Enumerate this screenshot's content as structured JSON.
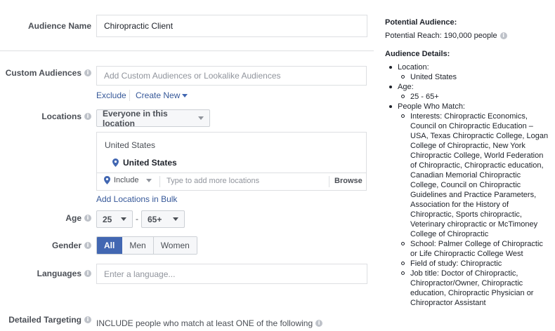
{
  "audience_name": {
    "label": "Audience Name",
    "value": "Chiropractic Client"
  },
  "custom_audiences": {
    "label": "Custom Audiences",
    "placeholder": "Add Custom Audiences or Lookalike Audiences",
    "exclude_link": "Exclude",
    "create_new_link": "Create New"
  },
  "locations": {
    "label": "Locations",
    "scope_select": "Everyone in this location",
    "group_label": "United States",
    "selected": "United States",
    "include_select": "Include",
    "search_placeholder": "Type to add more locations",
    "browse_button": "Browse",
    "bulk_link": "Add Locations in Bulk"
  },
  "age": {
    "label": "Age",
    "min": "25",
    "separator": "-",
    "max": "65+"
  },
  "gender": {
    "label": "Gender",
    "options": [
      "All",
      "Men",
      "Women"
    ],
    "selected": "All"
  },
  "languages": {
    "label": "Languages",
    "placeholder": "Enter a language..."
  },
  "detailed_targeting": {
    "label": "Detailed Targeting",
    "include_text": "INCLUDE people who match at least ONE of the following"
  },
  "sidebar": {
    "potential_audience_heading": "Potential Audience:",
    "potential_reach": "Potential Reach: 190,000 people",
    "audience_details_heading": "Audience Details:",
    "details": [
      {
        "label": "Location:",
        "sub": [
          "United States"
        ]
      },
      {
        "label": "Age:",
        "sub": [
          "25 - 65+"
        ]
      },
      {
        "label": "People Who Match:",
        "sub": [
          "Interests: Chiropractic Economics, Council on Chiropractic Education – USA, Texas Chiropractic College, Logan College of Chiropractic, New York Chiropractic College, World Federation of Chiropractic, Chiropractic education, Canadian Memorial Chiropractic College, Council on Chiropractic Guidelines and Practice Parameters, Association for the History of Chiropractic, Sports chiropractic, Veterinary chiropractic or McTimoney College of Chiropractic",
          "School: Palmer College of Chiropractic or Life Chiropractic College West",
          "Field of study: Chiropractic",
          "Job title: Doctor of Chiropractic, Chiropractor/Owner, Chiropractic education, Chiropractic Physician or Chiropractor Assistant"
        ]
      }
    ]
  },
  "colors": {
    "link": "#365899",
    "active_button": "#4267b2",
    "border": "#dddfe2",
    "label_text": "#4b4f56"
  },
  "icons": [
    "info-icon",
    "caret-down-icon",
    "location-pin-icon"
  ]
}
